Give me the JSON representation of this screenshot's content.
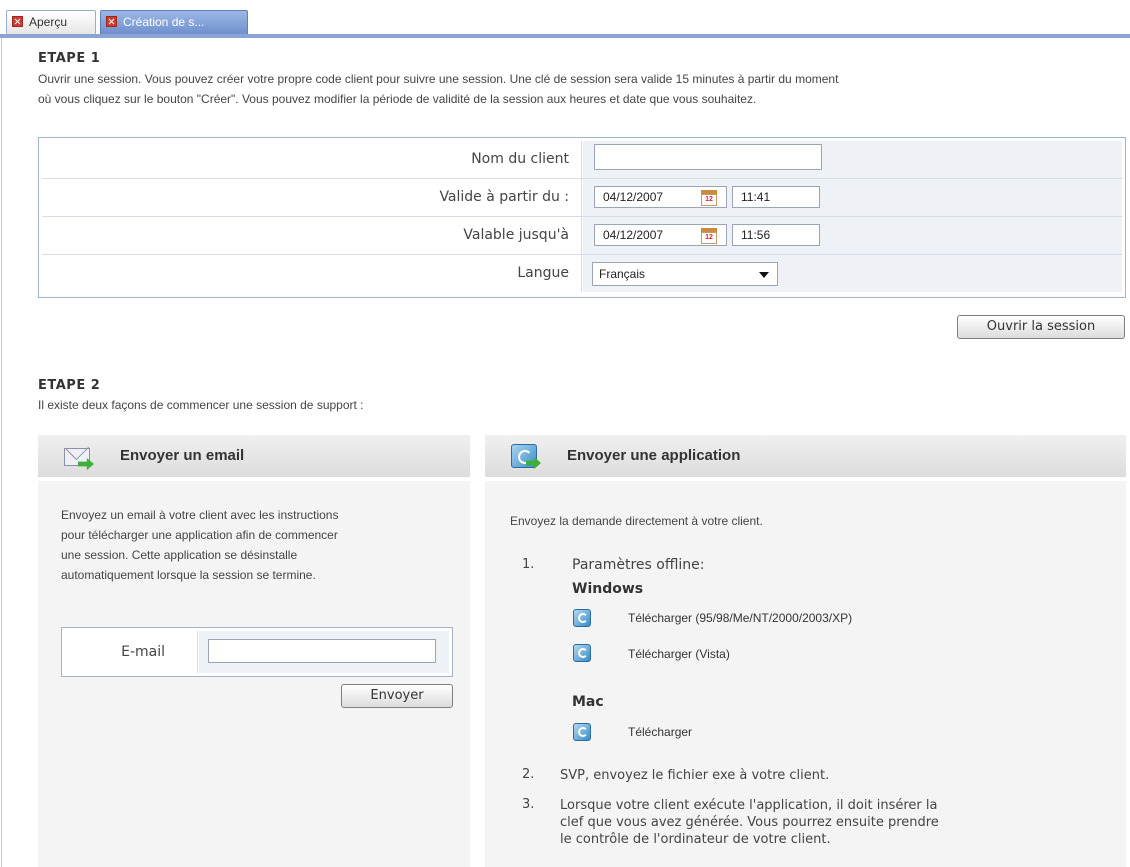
{
  "tabs": [
    {
      "label": "Aperçu"
    },
    {
      "label": "Création de s..."
    }
  ],
  "step1": {
    "title": "ETAPE 1",
    "description_line1": "Ouvrir une session. Vous pouvez créer votre propre code client pour suivre une session. Une clé de session sera valide 15 minutes à partir du moment",
    "description_line2": "où vous cliquez sur le bouton \"Créer\". Vous pouvez modifier la période de validité de la session aux heures et date que vous souhaitez.",
    "form": {
      "client_name_label": "Nom du client",
      "client_name_value": "",
      "valid_from_label": "Valide à partir du :",
      "valid_from_date": "04/12/2007",
      "valid_from_time": "11:41",
      "valid_until_label": "Valable jusqu'à",
      "valid_until_date": "04/12/2007",
      "valid_until_time": "11:56",
      "language_label": "Langue",
      "language_value": "Français",
      "calendar_icon_text": "12"
    },
    "open_button": "Ouvrir la session"
  },
  "step2": {
    "title": "ETAPE 2",
    "description": "Il existe deux façons de commencer une session de support :",
    "email_panel": {
      "title": "Envoyer un email",
      "text_lines": [
        "Envoyez un email à votre client avec les instructions",
        "pour télécharger une application afin de commencer",
        "une session. Cette application se désinstalle",
        "automatiquement lorsque la session se termine."
      ],
      "email_label": "E-mail",
      "email_value": "",
      "send_button": "Envoyer"
    },
    "app_panel": {
      "title": "Envoyer une application",
      "intro": "Envoyez la demande directement à votre client.",
      "item1_num": "1.",
      "item1_label": "Paramètres offline:",
      "windows_label": "Windows",
      "download_win": "Télécharger (95/98/Me/NT/2000/2003/XP)",
      "download_vista": "Télécharger (Vista)",
      "mac_label": "Mac",
      "download_mac": "Télécharger",
      "item2_num": "2.",
      "item2_text": "SVP, envoyez le fichier exe à votre client.",
      "item3_num": "3.",
      "item3_lines": [
        "Lorsque votre client exécute l'application, il doit insérer la",
        "clef que vous avez générée. Vous pourrez ensuite prendre",
        "le contrôle de l'ordinateur de votre client."
      ]
    }
  },
  "colors": {
    "tab_active": "#7f9fd8",
    "header_line": "#8aa4d4",
    "panel_bg": "#f4f4f4",
    "download_icon": "#3a8cc7"
  }
}
